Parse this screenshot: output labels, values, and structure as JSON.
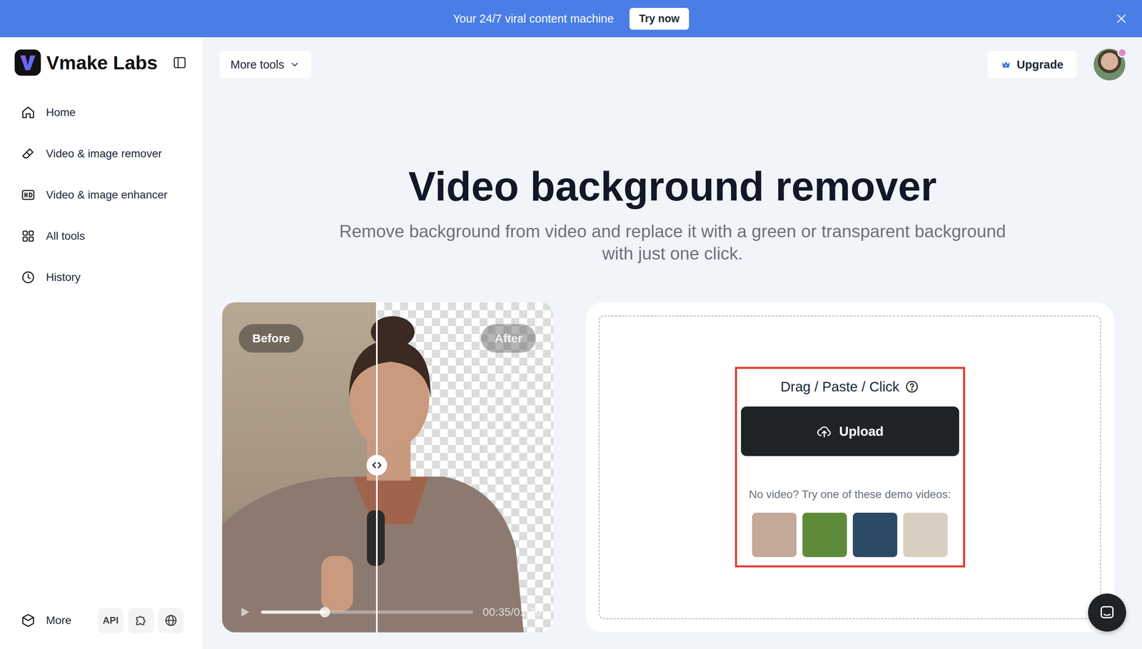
{
  "banner": {
    "text": "Your 24/7 viral content machine",
    "button": "Try now"
  },
  "brand": {
    "name": "Vmake Labs"
  },
  "sidebar": {
    "items": [
      {
        "label": "Home",
        "icon": "home",
        "selected": false
      },
      {
        "label": "Video & image remover",
        "icon": "eraser",
        "selected": false
      },
      {
        "label": "Video & image enhancer",
        "icon": "hd",
        "selected": false
      },
      {
        "label": "All tools",
        "icon": "grid",
        "selected": false
      },
      {
        "label": "History",
        "icon": "clock",
        "selected": false
      }
    ],
    "more": "More",
    "api": "API"
  },
  "header": {
    "more_tools": "More tools",
    "upgrade": "Upgrade"
  },
  "hero": {
    "title": "Video background remover",
    "subtitle_lines": [
      "Remove background from video and replace it with a green or transparent background",
      "with just one click."
    ]
  },
  "preview": {
    "before": "Before",
    "after": "After",
    "time": "00:35/01:30",
    "level": 0.3
  },
  "upload": {
    "hint": "Drag / Paste / Click",
    "button": "Upload",
    "demo_label": "No video? Try one of these demo videos:",
    "demos": [
      {
        "color": "#c4a99a"
      },
      {
        "color": "#5f8a3a"
      },
      {
        "color": "#2c4a66"
      },
      {
        "color": "#d8cfc0"
      }
    ]
  }
}
